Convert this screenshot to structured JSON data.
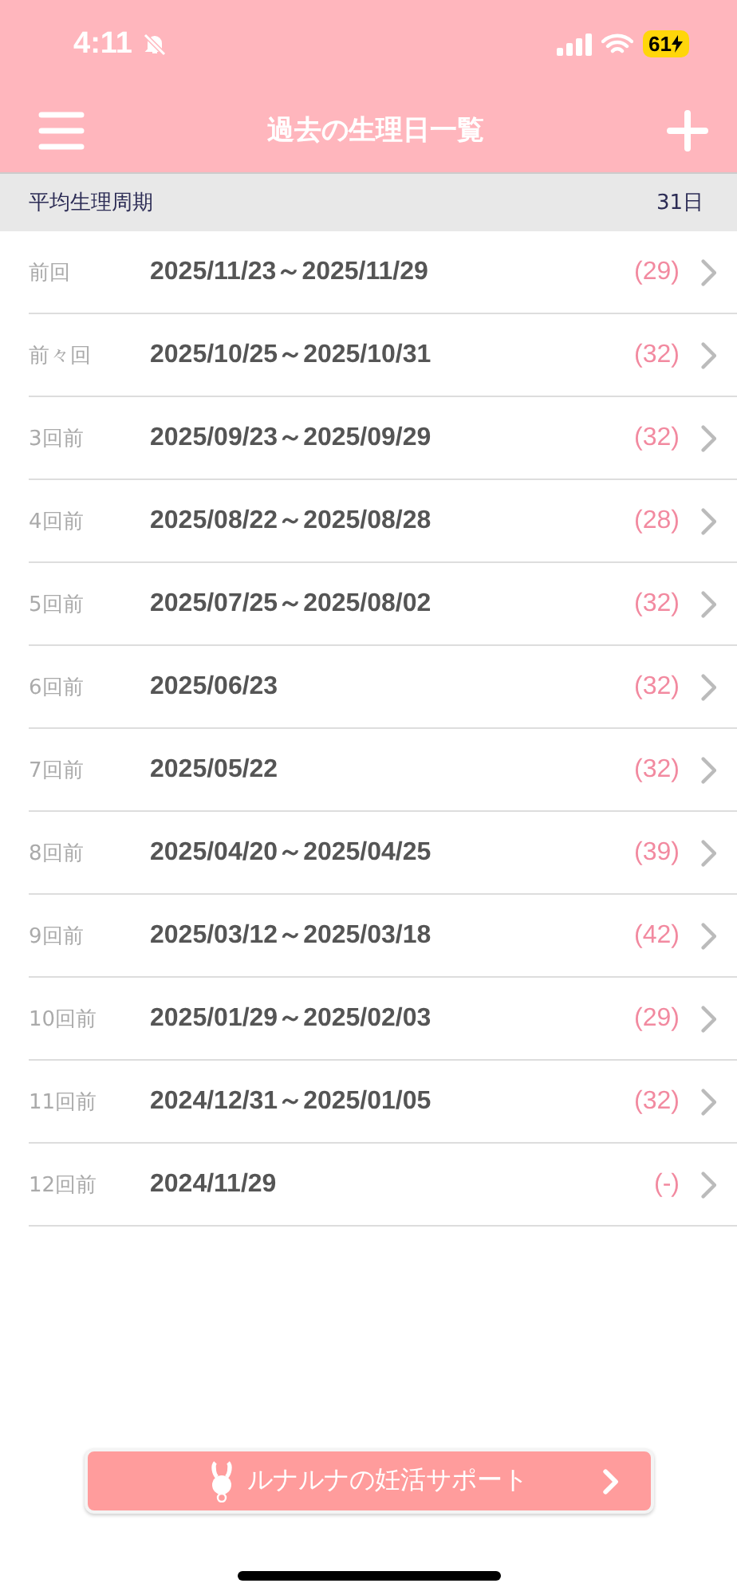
{
  "status_bar": {
    "time": "4:11",
    "battery": "61"
  },
  "header": {
    "title": "過去の生理日一覧"
  },
  "summary": {
    "label": "平均生理周期",
    "value": "31日"
  },
  "periods": [
    {
      "label": "前回",
      "dates": "2025/11/23～2025/11/29",
      "cycle": "(29)"
    },
    {
      "label": "前々回",
      "dates": "2025/10/25～2025/10/31",
      "cycle": "(32)"
    },
    {
      "label": "3回前",
      "dates": "2025/09/23～2025/09/29",
      "cycle": "(32)"
    },
    {
      "label": "4回前",
      "dates": "2025/08/22～2025/08/28",
      "cycle": "(28)"
    },
    {
      "label": "5回前",
      "dates": "2025/07/25～2025/08/02",
      "cycle": "(32)"
    },
    {
      "label": "6回前",
      "dates": "2025/06/23",
      "cycle": "(32)"
    },
    {
      "label": "7回前",
      "dates": "2025/05/22",
      "cycle": "(32)"
    },
    {
      "label": "8回前",
      "dates": "2025/04/20～2025/04/25",
      "cycle": "(39)"
    },
    {
      "label": "9回前",
      "dates": "2025/03/12～2025/03/18",
      "cycle": "(42)"
    },
    {
      "label": "10回前",
      "dates": "2025/01/29～2025/02/03",
      "cycle": "(29)"
    },
    {
      "label": "11回前",
      "dates": "2024/12/31～2025/01/05",
      "cycle": "(32)"
    },
    {
      "label": "12回前",
      "dates": "2024/11/29",
      "cycle": "(-)"
    }
  ],
  "support_button": {
    "label": "ルナルナの妊活サポート"
  }
}
